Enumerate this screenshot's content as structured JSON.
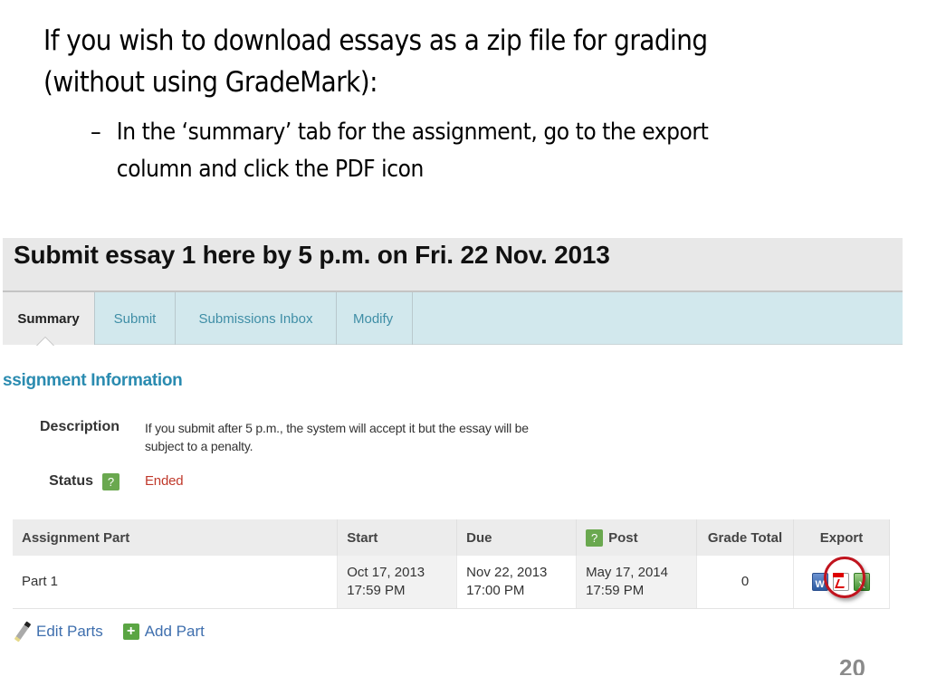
{
  "slide": {
    "heading_line1": "If you wish to download essays as a zip file for grading",
    "heading_line2": "(without using GradeMark):",
    "bullet_dash": "–",
    "bullet_line1": "In the ‘summary’ tab for the assignment, go to the export",
    "bullet_line2": "column and click the PDF icon",
    "page_number": "20"
  },
  "screenshot": {
    "title": "Submit essay 1 here by 5 p.m. on Fri. 22 Nov. 2013",
    "tabs": [
      {
        "label": "Summary",
        "active": true
      },
      {
        "label": "Submit",
        "active": false
      },
      {
        "label": "Submissions Inbox",
        "active": false
      },
      {
        "label": "Modify",
        "active": false
      }
    ],
    "section_title": "ssignment Information",
    "description_label": "Description",
    "description_line1": "If you submit after 5 p.m., the system will accept it but the essay will be",
    "description_line2": "subject to a penalty.",
    "status_label": "Status",
    "status_value": "Ended",
    "help_glyph": "?",
    "table": {
      "headers": [
        "Assignment Part",
        "Start",
        "Due",
        "Post",
        "Grade Total",
        "Export"
      ],
      "rows": [
        {
          "part": "Part 1",
          "start_date": "Oct 17, 2013",
          "start_time": "17:59 PM",
          "due_date": "Nov 22, 2013",
          "due_time": "17:00 PM",
          "post_date": "May 17, 2014",
          "post_time": "17:59 PM",
          "grade_total": "0",
          "export_icons": [
            "word-icon",
            "pdf-icon",
            "excel-icon"
          ]
        }
      ]
    },
    "actions": {
      "edit_parts": "Edit Parts",
      "add_part": "Add Part",
      "plus_glyph": "+"
    }
  },
  "colors": {
    "tab_bg": "#d2e8ed",
    "tab_text": "#3f8ea6",
    "section_title": "#2a8bb0",
    "status_ended": "#c0392b",
    "help_badge": "#6aa84f",
    "highlight_circle": "#c0141e",
    "link": "#3f6fae"
  }
}
